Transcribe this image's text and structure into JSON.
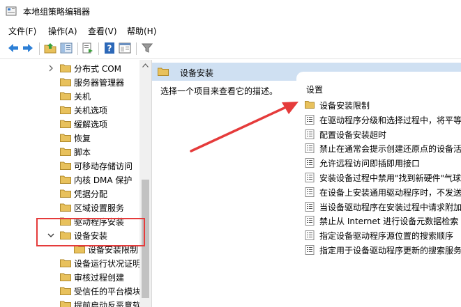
{
  "window": {
    "title": "本地组策略编辑器"
  },
  "menu": [
    {
      "label": "文件(F)"
    },
    {
      "label": "操作(A)"
    },
    {
      "label": "查看(V)"
    },
    {
      "label": "帮助(H)"
    }
  ],
  "toolbar": {
    "icons": [
      "back-arrow-icon",
      "forward-arrow-icon",
      "up-folder-icon",
      "show-hide-tree-icon",
      "export-list-icon",
      "help-icon",
      "properties-icon",
      "filter-icon"
    ]
  },
  "tree": {
    "items": [
      {
        "label": "分布式 COM",
        "expand": "right"
      },
      {
        "label": "服务器管理器"
      },
      {
        "label": "关机"
      },
      {
        "label": "关机选项"
      },
      {
        "label": "缓解选项"
      },
      {
        "label": "恢复"
      },
      {
        "label": "脚本"
      },
      {
        "label": "可移动存储访问"
      },
      {
        "label": "内核 DMA 保护"
      },
      {
        "label": "凭据分配"
      },
      {
        "label": "区域设置服务"
      },
      {
        "label": "驱动程序安装"
      },
      {
        "label": "设备安装",
        "expand": "down",
        "selected": true
      },
      {
        "label": "设备安装限制",
        "indent": true
      },
      {
        "label": "设备运行状况证明"
      },
      {
        "label": "审核过程创建"
      },
      {
        "label": "受信任的平台模块"
      },
      {
        "label": "提前启动反恶意软"
      }
    ]
  },
  "right": {
    "header": "设备安装",
    "description": "选择一个项目来查看它的描述。",
    "settings_header": "设置",
    "items": [
      {
        "label": "设备安装限制",
        "kind": "folder"
      },
      {
        "label": "在驱动程序分级和选择过程中，将平等",
        "kind": "setting"
      },
      {
        "label": "配置设备安装超时",
        "kind": "setting"
      },
      {
        "label": "禁止在通常会提示创建还原点的设备活",
        "kind": "setting"
      },
      {
        "label": "允许远程访问即插即用接口",
        "kind": "setting"
      },
      {
        "label": "安装设备过程中禁用\"找到新硬件\"气球",
        "kind": "setting"
      },
      {
        "label": "在设备上安装通用驱动程序时，不发送",
        "kind": "setting"
      },
      {
        "label": "当设备驱动程序在安装过程中请求附加",
        "kind": "setting"
      },
      {
        "label": "禁止从 Internet 进行设备元数据检索",
        "kind": "setting"
      },
      {
        "label": "指定设备驱动程序源位置的搜索顺序",
        "kind": "setting"
      },
      {
        "label": "指定用于设备驱动程序更新的搜索服务",
        "kind": "setting"
      }
    ]
  },
  "colors": {
    "highlight": "#e53b3b",
    "header_band": "#cfe0f2",
    "folder": "#e8c15c"
  }
}
